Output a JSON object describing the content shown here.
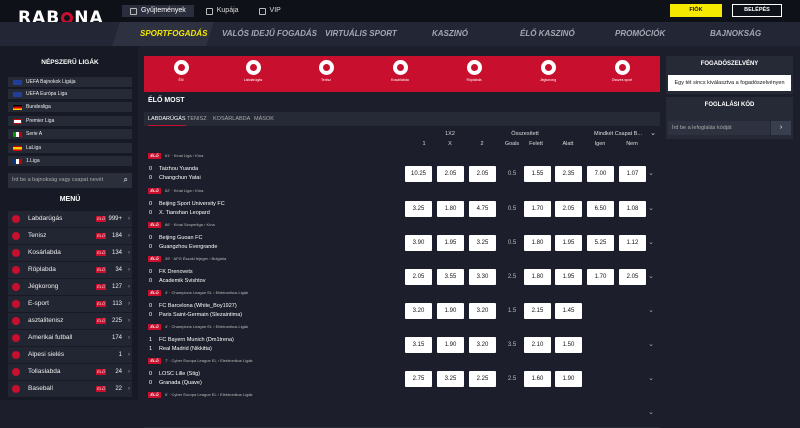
{
  "brand": {
    "logo": "RABONA"
  },
  "topnav": [
    {
      "label": "Gyűjtemények"
    },
    {
      "label": "Kupája"
    },
    {
      "label": "VIP"
    }
  ],
  "auth": {
    "register": "FIÓK LÉTREHOZÁSA",
    "login": "BELÉPÉS"
  },
  "mainnav": [
    "SPORTFOGADÁS",
    "VALÓS IDEJŰ FOGADÁS",
    "VIRTUÁLIS SPORT",
    "KASZINÓ",
    "ÉLŐ KASZINÓ",
    "PROMÓCIÓK",
    "BAJNOKSÁG"
  ],
  "sidebar": {
    "popular_title": "NÉPSZERŰ LIGÁK",
    "leagues": [
      {
        "label": "UEFA Bajnokok Ligája",
        "flag": "eu"
      },
      {
        "label": "UEFA Európa Liga",
        "flag": "eu"
      },
      {
        "label": "Bundesliga",
        "flag": "de"
      },
      {
        "label": "Premier Liga",
        "flag": "en"
      },
      {
        "label": "Serie A",
        "flag": "it"
      },
      {
        "label": "LaLiga",
        "flag": "es"
      },
      {
        "label": "1.Liga",
        "flag": "fr"
      }
    ],
    "search_placeholder": "Írd be a bajnokság vagy csapat nevét",
    "menu_title": "MENÜ",
    "sports": [
      {
        "label": "Labdarúgás",
        "elo": "ÉLŐ",
        "count": "999+"
      },
      {
        "label": "Tenisz",
        "elo": "ÉLŐ",
        "count": "184"
      },
      {
        "label": "Kosárlabda",
        "elo": "ÉLŐ",
        "count": "134"
      },
      {
        "label": "Röplabda",
        "elo": "ÉLŐ",
        "count": "34"
      },
      {
        "label": "Jégkorong",
        "elo": "ÉLŐ",
        "count": "127"
      },
      {
        "label": "E-sport",
        "elo": "ÉLŐ",
        "count": "113"
      },
      {
        "label": "asztalitenisz",
        "elo": "ÉLŐ",
        "count": "225"
      },
      {
        "label": "Amerikai futball",
        "elo": "",
        "count": "174"
      },
      {
        "label": "Alpesi sielés",
        "elo": "",
        "count": "1"
      },
      {
        "label": "Tollaslabda",
        "elo": "ÉLŐ",
        "count": "24"
      },
      {
        "label": "Baseball",
        "elo": "ÉLŐ",
        "count": "22"
      }
    ]
  },
  "sportbar": [
    "Élő",
    "Labdarúgás",
    "Tenisz",
    "Kosárlabda",
    "Röplabda",
    "Jégkorong",
    "Összes sport"
  ],
  "live": {
    "title": "ÉLŐ MOST",
    "tabs": [
      "LABDARÚGÁS",
      "TENISZ",
      "KOSÁRLABDA",
      "MÁSOK"
    ],
    "headers": {
      "g1": "1X2",
      "g2": "Összesített",
      "g3": "Mindkét Csapat B...",
      "h1": "1",
      "hx": "X",
      "h2": "2",
      "goals": "Goals",
      "over": "Felett",
      "under": "Alatt",
      "yes": "Igen",
      "no": "Nem"
    },
    "matches": [
      {
        "badge": "ÉLŐ",
        "meta": "61' · Kínai Liga › Kína",
        "home": "Taizhou Yuanda",
        "away": "Changchun Yatai",
        "sh": "0",
        "sa": "0",
        "o1": "10.25",
        "ox": "2.05",
        "o2": "2.05",
        "goals": "0.5",
        "over": "1.55",
        "under": "2.35",
        "yes": "7.00",
        "no": "1.07"
      },
      {
        "badge": "ÉLŐ",
        "meta": "62' · Kínai Liga › Kína",
        "home": "Beijing Sport University FC",
        "away": "X. Tianshan Leopard",
        "sh": "0",
        "sa": "0",
        "o1": "3.25",
        "ox": "1.80",
        "o2": "4.75",
        "goals": "0.5",
        "over": "1.70",
        "under": "2.05",
        "yes": "6.50",
        "no": "1.08"
      },
      {
        "badge": "ÉLŐ",
        "meta": "66' · Kínai Szuperliga › Kína",
        "home": "Beijing Guoan FC",
        "away": "Guangzhou Evergrande",
        "sh": "0",
        "sa": "0",
        "o1": "3.90",
        "ox": "1.95",
        "o2": "3.25",
        "goals": "0.5",
        "over": "1.80",
        "under": "1.95",
        "yes": "5.25",
        "no": "1.12"
      },
      {
        "badge": "ÉLŐ",
        "meta": "39' · AFG Északi fejegér › Bulgária",
        "home": "FK Drenovets",
        "away": "Academik Svishtov",
        "sh": "0",
        "sa": "0",
        "o1": "2.05",
        "ox": "3.55",
        "o2": "3.30",
        "goals": "2.5",
        "over": "1.80",
        "under": "1.95",
        "yes": "1.70",
        "no": "2.05"
      },
      {
        "badge": "ÉLŐ",
        "meta": "4' · Champions League EL › Elektronikus Ligák",
        "home": "FC Barcelona (White_Boy1927)",
        "away": "Paris Saint-Germain (Slezaintima)",
        "sh": "0",
        "sa": "0",
        "o1": "3.20",
        "ox": "1.90",
        "o2": "3.20",
        "goals": "1.5",
        "over": "2.15",
        "under": "1.45",
        "yes": "",
        "no": ""
      },
      {
        "badge": "ÉLŐ",
        "meta": "4' · Champions League EL › Elektronikus Ligák",
        "home": "FC Bayern Munich (Dm1trena)",
        "away": "Real Madrid (Nikkitta)",
        "sh": "1",
        "sa": "1",
        "o1": "3.15",
        "ox": "1.90",
        "o2": "3.20",
        "goals": "3.5",
        "over": "2.10",
        "under": "1.50",
        "yes": "",
        "no": ""
      },
      {
        "badge": "ÉLŐ",
        "meta": "7' · Cyber Europa League EL › Elektronikus Ligák",
        "home": "LOSC Lille (Stig)",
        "away": "Granada (Quave)",
        "sh": "0",
        "sa": "0",
        "o1": "2.75",
        "ox": "3.25",
        "o2": "2.25",
        "goals": "2.5",
        "over": "1.60",
        "under": "1.90",
        "yes": "",
        "no": ""
      },
      {
        "badge": "ÉLŐ",
        "meta": "6' · Cyber Europa League EL › Elektronikus Ligák",
        "home": "",
        "away": "",
        "sh": "",
        "sa": "",
        "o1": "",
        "ox": "",
        "o2": "",
        "goals": "",
        "over": "",
        "under": "",
        "yes": "",
        "no": ""
      }
    ]
  },
  "right": {
    "betslip_title": "FOGADÓSZELVÉNY",
    "betslip_empty": "Egy tét sincs kiválasztva a fogadószelvényen",
    "code_title": "FOGLALÁSI KÓD",
    "code_placeholder": "Írd be a lefoglalás kódját"
  }
}
